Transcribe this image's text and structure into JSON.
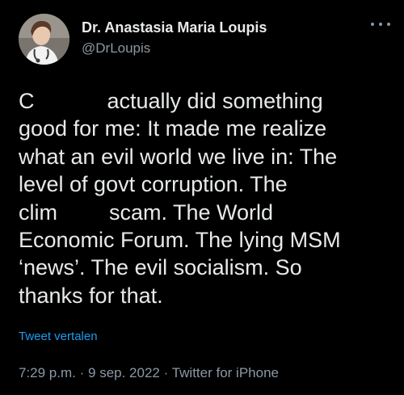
{
  "author": {
    "display_name": "Dr. Anastasia Maria Loupis",
    "handle": "@DrLoupis"
  },
  "tweet": {
    "lines": [
      {
        "a": "C",
        "b": "actually did something"
      },
      {
        "a": "good for me: It made me realize"
      },
      {
        "a": "what an evil world we live in: The"
      },
      {
        "a": "level of govt corruption. The"
      },
      {
        "a": "clim",
        "b": "scam. The World"
      },
      {
        "a": "Economic Forum. The lying MSM"
      },
      {
        "a": "‘news’. The evil socialism. So"
      },
      {
        "a": "thanks for that."
      }
    ]
  },
  "translate_link": "Tweet vertalen",
  "meta": {
    "time": "7:29 p.m.",
    "separator": "·",
    "date": "9 sep. 2022",
    "source": "Twitter for iPhone"
  },
  "colors": {
    "background": "#000000",
    "text": "#e7e9ea",
    "secondary": "#8b98a5",
    "link": "#1d9bf0"
  },
  "icons": [
    "avatar-photo",
    "more-options-icon"
  ]
}
